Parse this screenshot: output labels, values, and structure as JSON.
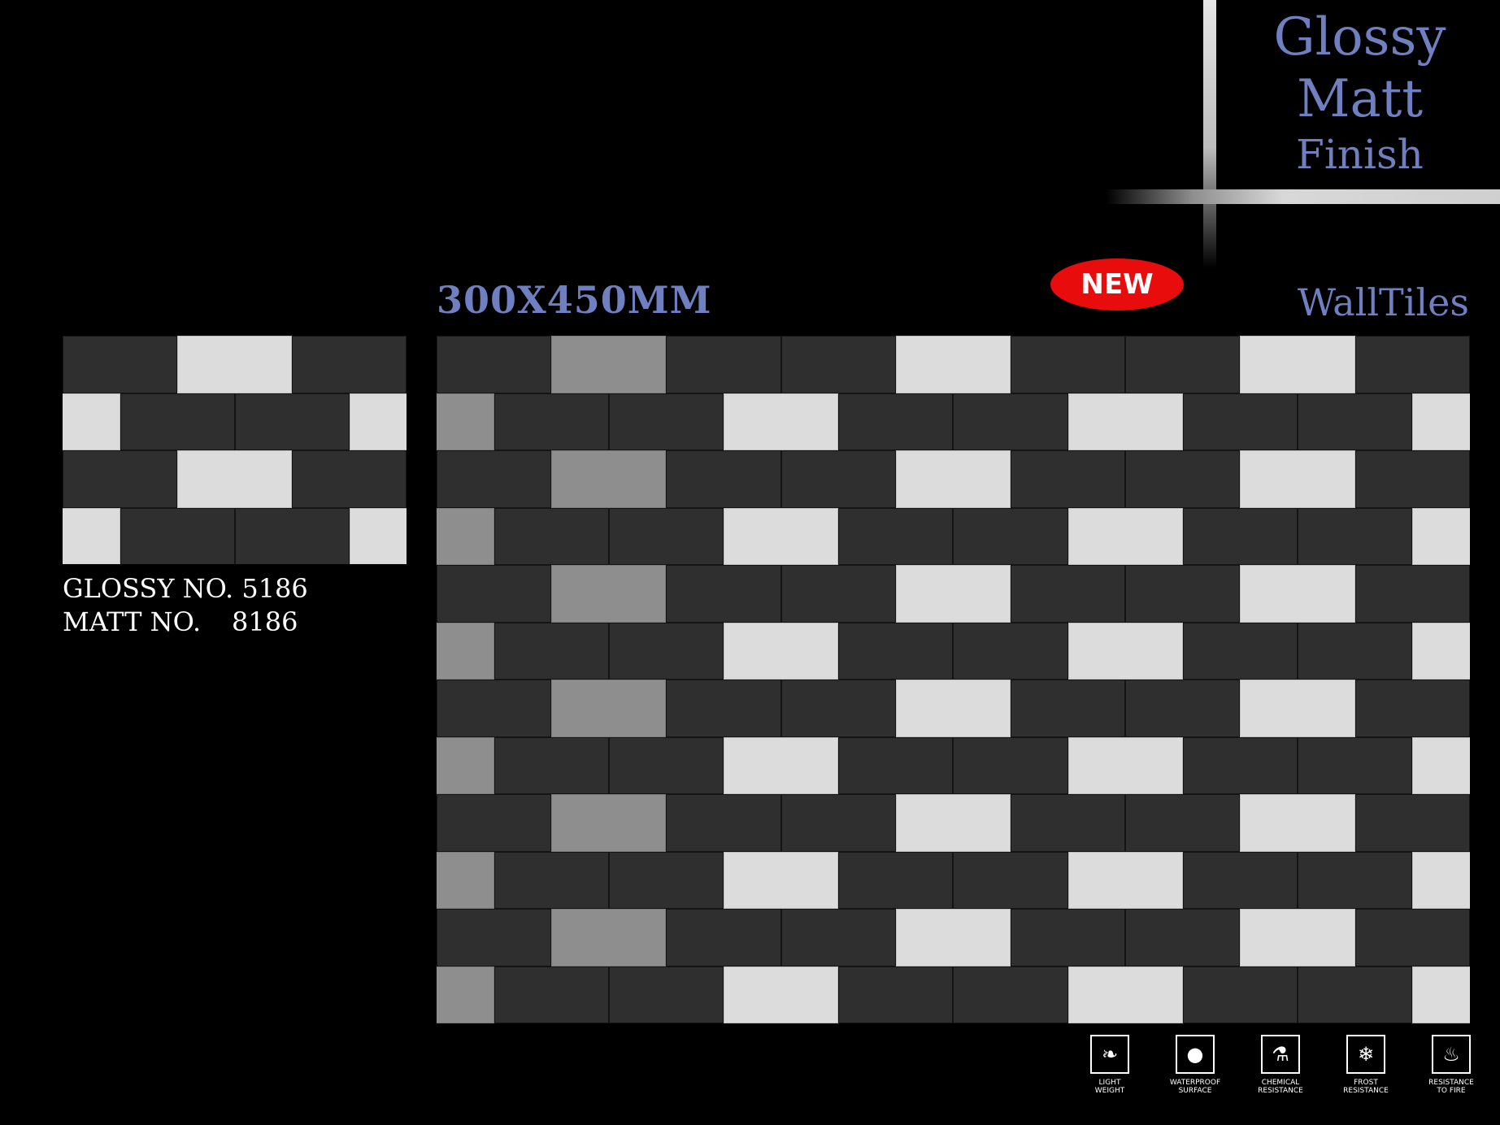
{
  "finish": {
    "line1": "Glossy",
    "line2": "Matt",
    "line3": "Finish"
  },
  "size": "300X450MM",
  "badge": "NEW",
  "category": "WallTiles",
  "codes": {
    "glossy_label": "GLOSSY NO.",
    "glossy_number": "5186",
    "matt_label": "MATT NO.",
    "matt_number": "8186"
  },
  "features": [
    {
      "icon": "feather-icon",
      "glyph": "❧",
      "line1": "LIGHT",
      "line2": "WEIGHT"
    },
    {
      "icon": "water-drop-icon",
      "glyph": "●",
      "line1": "WATERPROOF",
      "line2": "SURFACE"
    },
    {
      "icon": "flask-icon",
      "glyph": "⚗",
      "line1": "CHEMICAL",
      "line2": "RESISTANCE"
    },
    {
      "icon": "snowflake-icon",
      "glyph": "❄",
      "line1": "FROST",
      "line2": "RESISTANCE"
    },
    {
      "icon": "flame-icon",
      "glyph": "♨",
      "line1": "RESISTANCE",
      "line2": "TO FIRE"
    }
  ],
  "colors": {
    "accent": "#6f7fbf",
    "badge": "#e80c0c",
    "background": "#000000"
  }
}
